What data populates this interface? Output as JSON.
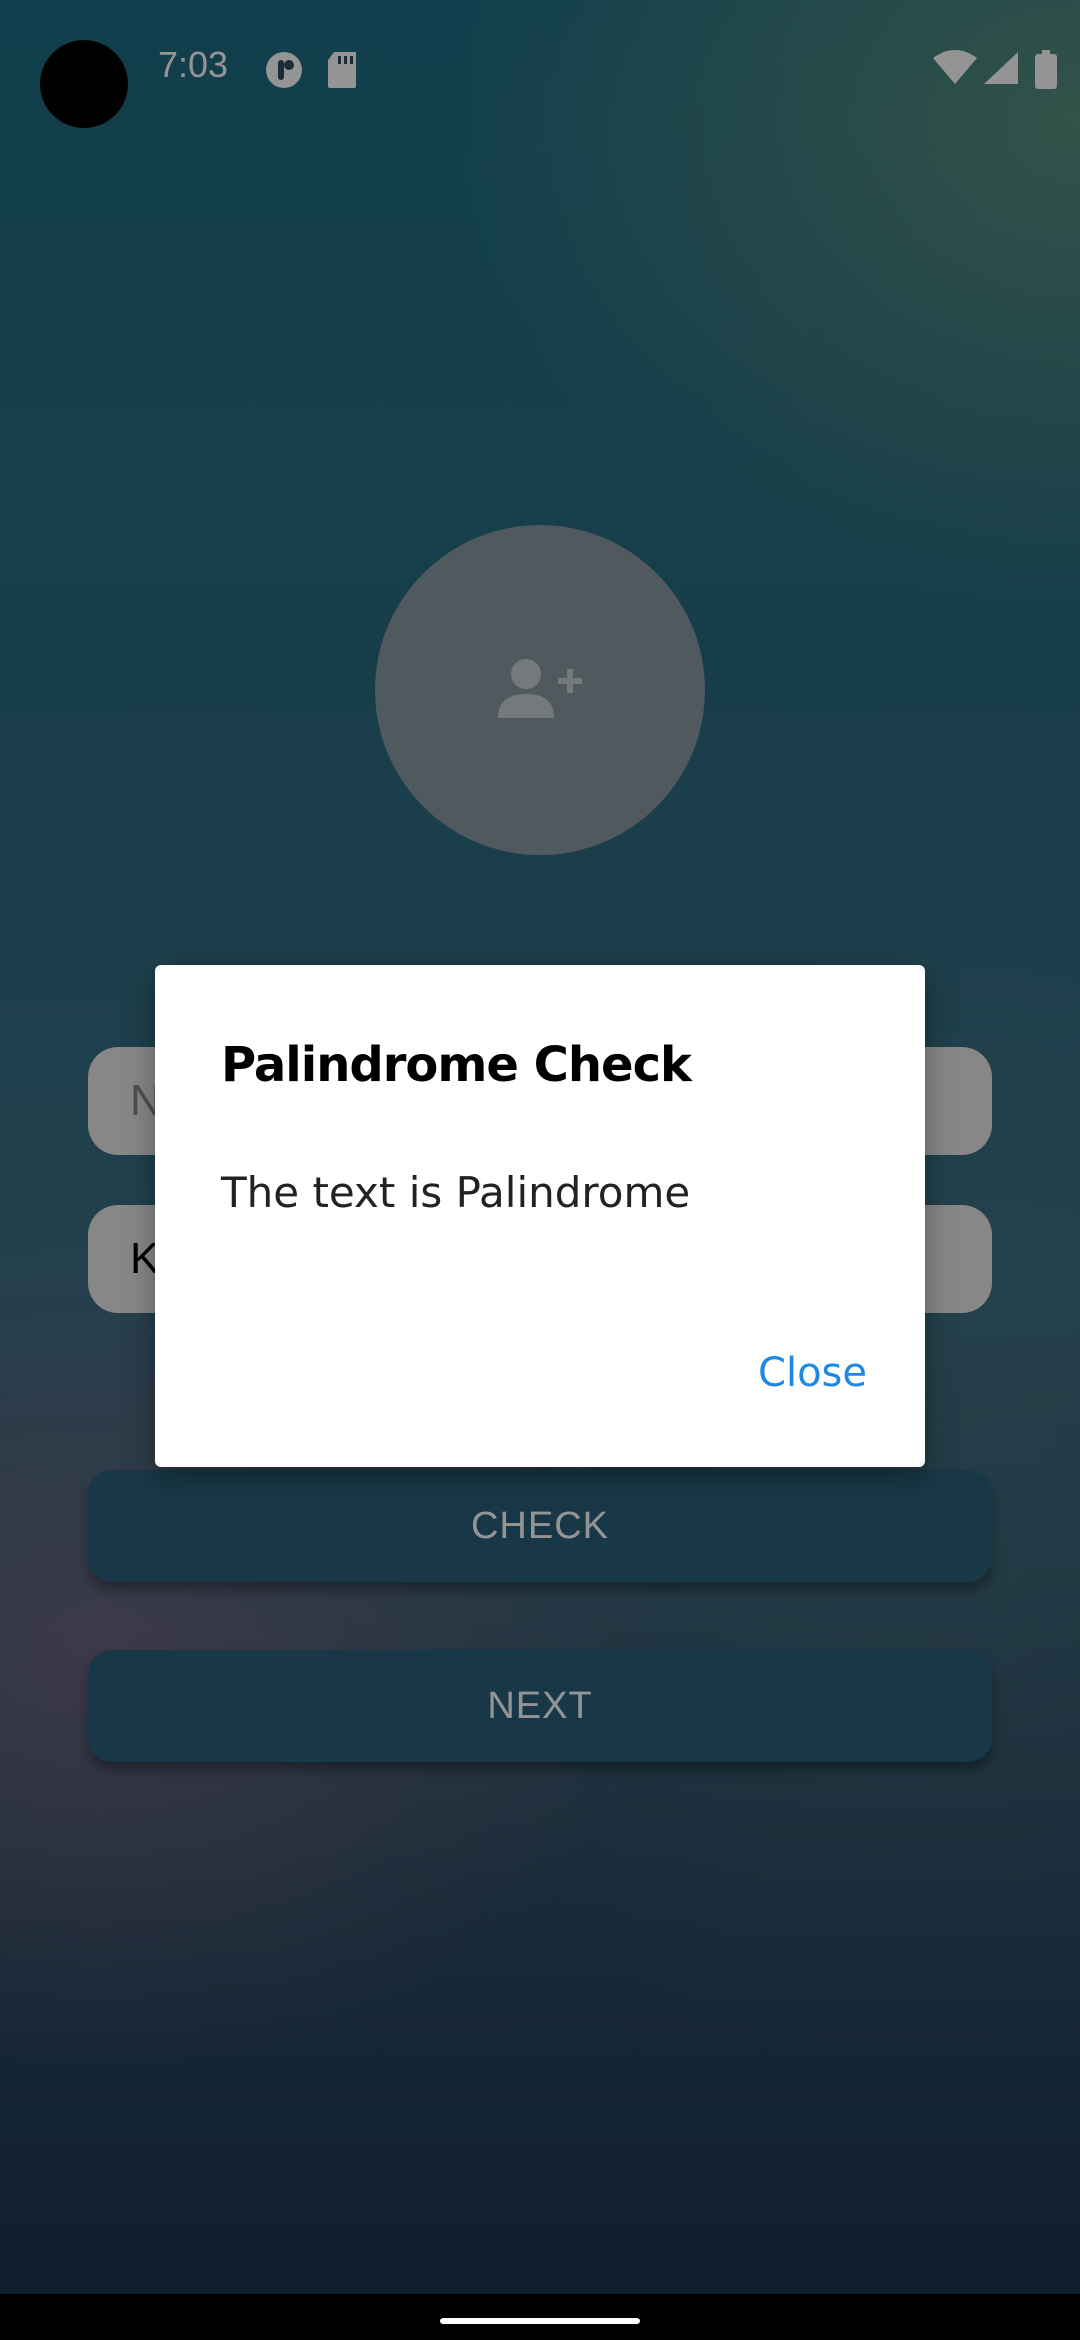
{
  "status_bar": {
    "time": "7:03"
  },
  "icons": {
    "avatar": "person-add-icon",
    "status_left": [
      "sync-icon",
      "sd-card-icon"
    ],
    "status_right": [
      "wifi-icon",
      "signal-icon",
      "battery-icon"
    ]
  },
  "form": {
    "name_field_visible_text": "N",
    "palindrome_field_visible_text": "K"
  },
  "buttons": {
    "check_label": "CHECK",
    "next_label": "NEXT"
  },
  "dialog": {
    "title": "Palindrome Check",
    "message": "The text is Palindrome",
    "close_label": "Close"
  },
  "colors": {
    "accent_link": "#1e88e5",
    "button_bg": "#2b617a"
  }
}
